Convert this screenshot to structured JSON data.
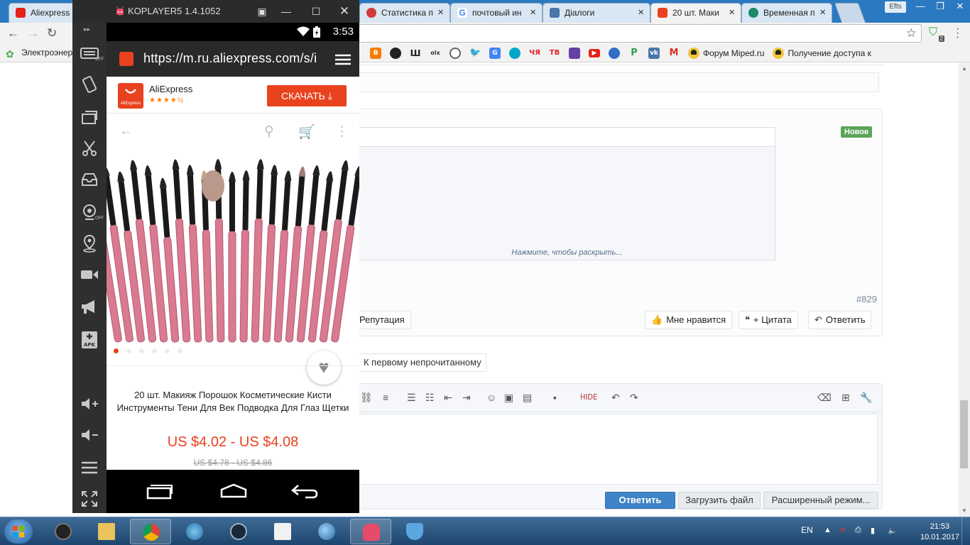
{
  "browser": {
    "tabs": [
      {
        "title": "Aliexpress по",
        "favicon": "youtube-icon",
        "color": "#e62117"
      },
      {
        "title": "Статистика п",
        "favicon": "stats-icon",
        "color": "#d23a3a"
      },
      {
        "title": "почтовый ин",
        "favicon": "google-icon",
        "color": "#4285f4"
      },
      {
        "title": "Діалоги",
        "favicon": "vk-icon",
        "color": "#4a76a8"
      },
      {
        "title": "20 шт. Маки",
        "favicon": "aliexpress-icon",
        "color": "#e8421e"
      },
      {
        "title": "Временная п",
        "favicon": "globe-icon",
        "color": "#1a8a6a"
      }
    ],
    "bookmarks": {
      "first": "Электроэнер",
      "icons": [
        {
          "name": "blogger-bookmark",
          "label": "",
          "color": "#f57d00"
        },
        {
          "name": "face-bookmark",
          "label": "",
          "color": "#333333"
        },
        {
          "name": "shazam-bookmark",
          "label": "Ш",
          "color": "#f2f2f2"
        },
        {
          "name": "olx-bookmark",
          "label": "olx",
          "color": "#f2f2f2"
        },
        {
          "name": "film-bookmark",
          "label": "",
          "color": "#666666"
        },
        {
          "name": "twitter-bookmark",
          "label": "",
          "color": "#1da1f2"
        },
        {
          "name": "translate-bookmark",
          "label": "",
          "color": "#4285f4"
        },
        {
          "name": "vk-alt-bookmark",
          "label": "",
          "color": "#00a6c8"
        },
        {
          "name": "kiev-bookmark",
          "label": "ЧЯ",
          "color": "#e21e26"
        },
        {
          "name": "tv-bookmark",
          "label": "ТВ",
          "color": "#e21e26"
        },
        {
          "name": "twitch-bookmark",
          "label": "",
          "color": "#6441a5"
        },
        {
          "name": "youtube-bookmark",
          "label": "",
          "color": "#e62117"
        },
        {
          "name": "web-bookmark",
          "label": "",
          "color": "#2e6ec7"
        },
        {
          "name": "parking-bookmark",
          "label": "P",
          "color": "#2e9e4f"
        },
        {
          "name": "vk-bookmark",
          "label": "",
          "color": "#4a76a8"
        },
        {
          "name": "gmail-bookmark",
          "label": "M",
          "color": "#d93025"
        }
      ],
      "forum": "Форум Miped.ru",
      "access": "Получение доступа к"
    },
    "extension_badge": "2"
  },
  "forum": {
    "badge_new": "Новое",
    "expand_quote": "Нажмите, чтобы раскрыть...",
    "post_number": "#829",
    "reputation": "Репутация",
    "like": "Мне нравится",
    "quote": "+ Цитата",
    "reply": "Ответить",
    "first_unread": "К первому непрочитанному",
    "editor_hide": "HIDE",
    "submit": "Ответить",
    "upload": "Загрузить файл",
    "advanced": "Расширенный режим..."
  },
  "koplayer": {
    "title": "KOPLAYER5 1.4.1052"
  },
  "android": {
    "clock": "3:53",
    "url": "https://m.ru.aliexpress.com/s/i",
    "app_name": "AliExpress",
    "app_icon_text": "AliExpress",
    "rating_stars": "★★★★½",
    "download": "СКАЧАТЬ",
    "product_title": "20 шт. Макияж Порошок Косметические Кисти Инструменты Тени Для Век Подводка Для Глаз Щетки",
    "price": "US $4.02 - US $4.08",
    "old_price": "US $4.78 - US $4.86",
    "slides": 6,
    "active_slide": 0
  },
  "taskbar": {
    "lang": "EN",
    "time": "21:53",
    "date": "10.01.2017"
  }
}
